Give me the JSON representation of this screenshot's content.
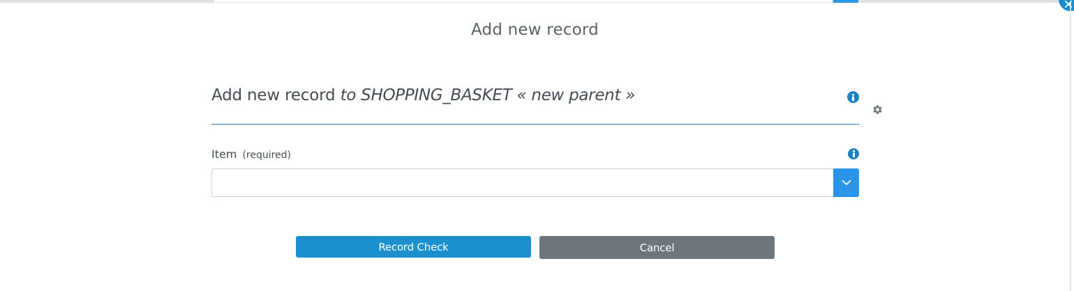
{
  "modal": {
    "title": "Add new record"
  },
  "form": {
    "heading_main": "Add new record",
    "heading_sub": "to SHOPPING_BASKET « new parent »",
    "field": {
      "label": "Item",
      "required_text": "(required)",
      "value": ""
    }
  },
  "actions": {
    "record_check_label": "Record Check",
    "cancel_label": "Cancel"
  },
  "icons": {
    "close": "close-icon",
    "info": "info-icon",
    "settings": "gear-icon",
    "dropdown": "chevron-down-icon"
  },
  "colors": {
    "accent": "#1c8fcd",
    "dropdown_button": "#2a95e8",
    "cancel": "#6f757c",
    "heading_rule": "#1f7fb8"
  }
}
